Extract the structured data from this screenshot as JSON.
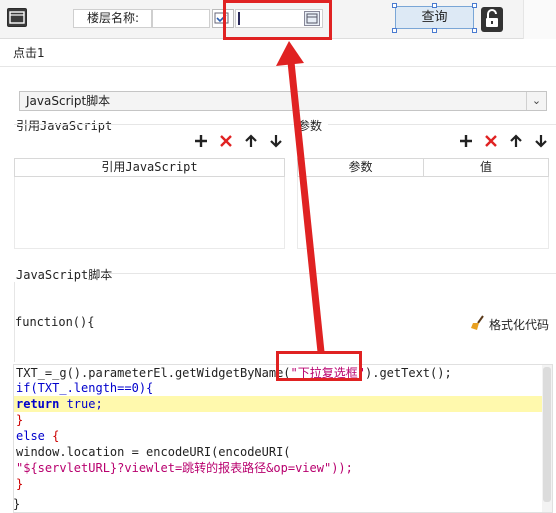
{
  "top": {
    "floor_label": "楼层名称:",
    "query_label": "查询"
  },
  "event_name": "点击1",
  "lang_select": {
    "selected": "JavaScript脚本"
  },
  "ref_js": {
    "label": "引用JavaScript",
    "col_header": "引用JavaScript"
  },
  "params": {
    "label": "参数",
    "col_param": "参数",
    "col_value": "值"
  },
  "toolbar_icons": [
    "plus-icon",
    "delete-icon",
    "arrow-up-icon",
    "arrow-down-icon"
  ],
  "script": {
    "label": "JavaScript脚本",
    "func_header": "function(){",
    "format_label": "格式化代码",
    "footer": "}"
  },
  "code": {
    "l1_a": "TXT_=_g().parameterEl.getWidgetByName(",
    "l1_str": "\"下拉复选框\"",
    "l1_b": ").getText();",
    "l2": "if(TXT_.length==0){",
    "l3_kw": "return",
    "l3_b": " true;",
    "l4": "}",
    "l5_kw": "else",
    "l5_b": " {",
    "l6": "window.location = encodeURI(encodeURI(",
    "l7": "\"${servletURL}?viewlet=跳转的报表路径&op=view\"));",
    "l8": "}"
  },
  "colors": {
    "accent_red": "#e02222",
    "highlight": "#fff9ad",
    "keyword": "#0000cc",
    "string": "#b8006e"
  }
}
